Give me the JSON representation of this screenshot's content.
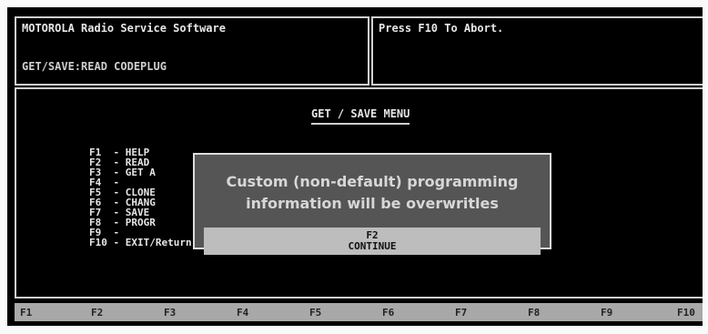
{
  "header": {
    "app_title": "MOTOROLA Radio Service Software",
    "status": "GET/SAVE:READ CODEPLUG",
    "abort_hint": "Press F10 To Abort."
  },
  "menu": {
    "title": "GET / SAVE MENU",
    "items": [
      "F1  - HELP",
      "F2  - READ",
      "F3  - GET A",
      "F4  -",
      "F5  - CLONE",
      "F6  - CHANG",
      "F7  - SAVE",
      "F8  - PROGR",
      "F9  -",
      "F10 - EXIT/Return To MAIN Menu"
    ]
  },
  "dialog": {
    "line1": "Custom (non-default) programming",
    "line2": "information will be overwritles",
    "button_key": "F2",
    "button_label": "CONTINUE"
  },
  "function_keys": [
    "F1",
    "F2",
    "F3",
    "F4",
    "F5",
    "F6",
    "F7",
    "F8",
    "F9",
    "F10"
  ]
}
